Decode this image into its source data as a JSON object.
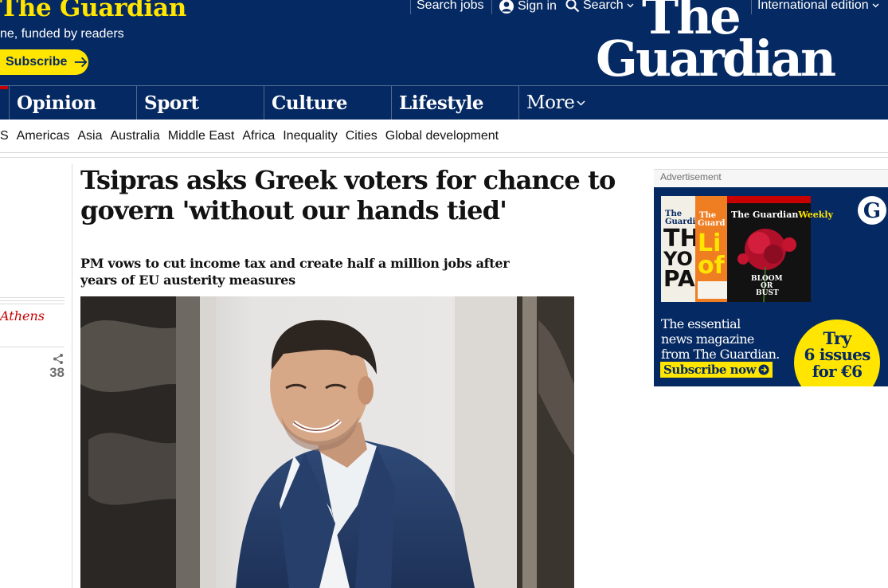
{
  "header": {
    "support_title": "The Guardian",
    "support_subtitle": "ne, funded by readers",
    "subscribe_label": "Subscribe",
    "search_jobs": "Search jobs",
    "sign_in": "Sign in",
    "search": "Search",
    "edition": "International edition",
    "logo_line1": "The",
    "logo_line2": "Guardian"
  },
  "pillars": [
    "Opinion",
    "Sport",
    "Culture",
    "Lifestyle",
    "More"
  ],
  "subnav": [
    "JS",
    "Americas",
    "Asia",
    "Australia",
    "Middle East",
    "Africa",
    "Inequality",
    "Cities",
    "Global development"
  ],
  "meta": {
    "byline": "Athens",
    "share_count": "38"
  },
  "article": {
    "headline": "Tsipras asks Greek voters for chance to govern 'without our hands tied'",
    "standfirst": "PM vows to cut income tax and create half a million jobs after years of EU austerity measures"
  },
  "advert": {
    "label": "Advertisement",
    "text_line1": "The essential",
    "text_line2": "news magazine",
    "text_line3": "from The Guardian.",
    "cta": "Subscribe now",
    "offer_line1": "Try",
    "offer_line2": "6 issues",
    "offer_line3": "for €6",
    "mag_title": "The GuardianWeekly",
    "mag_cover_text1": "BLOOM",
    "mag_cover_text2": "OR",
    "mag_cover_text3": "BUST"
  },
  "colors": {
    "brand_blue": "#052962",
    "brand_yellow": "#ffe500",
    "news_red": "#c70000"
  }
}
